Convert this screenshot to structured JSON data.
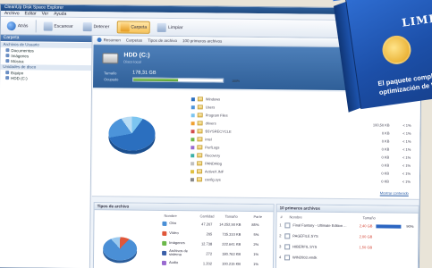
{
  "window": {
    "title": "CleanUp Disk Space Explorer"
  },
  "menu": [
    "Archivo",
    "Editar",
    "Ver",
    "Ayuda"
  ],
  "toolbar": {
    "back": "Atrás",
    "scan": "Escanear",
    "stop": "Detener",
    "folder_btn": "Carpeta",
    "clean_btn": "Limpiar"
  },
  "sidebar": {
    "header": "Carpeta",
    "group1": "Archivos de Usuario",
    "items1": [
      "Documentos",
      "Imágenes",
      "Música"
    ],
    "group2": "Unidades de disco",
    "items2": [
      "Equipo",
      "HDD (C:)"
    ]
  },
  "crumb": {
    "a": "Resumen",
    "b": "Carpetas",
    "c": "Tipos de archivo",
    "d": "100 primeros archivos"
  },
  "drive": {
    "title": "HDD (C:)",
    "subtitle": "Disco local",
    "cap_label": "Tamaño",
    "cap_value": "178,31 GB",
    "occ_label": "Ocupado",
    "occ_pct": "100%",
    "occ_fraction": 0.5
  },
  "folders": [
    {
      "name": "Windows",
      "size": "",
      "pct": ""
    },
    {
      "name": "Users",
      "size": "",
      "pct": ""
    },
    {
      "name": "Program Files",
      "size": "",
      "pct": ""
    },
    {
      "name": "drivers",
      "size": "100,50 KB",
      "pct": "< 1%"
    },
    {
      "name": "$SYSRECYCLE",
      "size": "0 KB",
      "pct": "< 1%"
    },
    {
      "name": "intel",
      "size": "0 KB",
      "pct": "< 1%"
    },
    {
      "name": "PerfLogs",
      "size": "0 KB",
      "pct": "< 1%"
    },
    {
      "name": "Recovery",
      "size": "0 KB",
      "pct": "< 1%"
    },
    {
      "name": "PANDAlog",
      "size": "0 KB",
      "pct": "< 1%"
    },
    {
      "name": "ActiveX.INF",
      "size": "0 KB",
      "pct": "< 1%"
    },
    {
      "name": "config.sys",
      "size": "0 KB",
      "pct": "< 1%"
    }
  ],
  "folder_colors": [
    "#2b6fbf",
    "#4c94da",
    "#7cc5f0",
    "#f0a030",
    "#d24c4c",
    "#6bb84a",
    "#9a6ad0",
    "#3cb0a8",
    "#c0c0c0",
    "#e0c040",
    "#888888"
  ],
  "more_link": "Mostrar contenido",
  "types_panel": {
    "title": "Tipos de archivo",
    "headers": [
      "Nombre",
      "Cantidad",
      "Tamaño",
      "Parte"
    ],
    "rows": [
      {
        "name": "Otro",
        "count": "47.207",
        "size": "14.252,50 KB",
        "pct": "85%",
        "color": "#4a8fd6"
      },
      {
        "name": "Vídeo",
        "count": "205",
        "size": "735.310 KB",
        "pct": "5%",
        "color": "#e0573a"
      },
      {
        "name": "Imágenes",
        "count": "12.738",
        "size": "222.641 KB",
        "pct": "2%",
        "color": "#6bb84a"
      },
      {
        "name": "Archivos de sistema",
        "count": "272",
        "size": "180.763 KB",
        "pct": "1%",
        "color": "#3a5fa8"
      },
      {
        "name": "Audio",
        "count": "1.202",
        "size": "100.215 KB",
        "pct": "1%",
        "color": "#9a6ad0"
      }
    ]
  },
  "largest_panel": {
    "title": "10 primeros archivos",
    "headers": [
      "#",
      "Nombre",
      "Tamaño"
    ],
    "rows": [
      {
        "n": "1",
        "name": "Final Fantasy - Ultimate Edition ...",
        "size": "2,40 GB",
        "pct": "90%"
      },
      {
        "n": "2",
        "name": "PAGEFILE.SYS",
        "size": "2,00 GB",
        "pct": ""
      },
      {
        "n": "3",
        "name": "HIBERFIL.SYS",
        "size": "1,50 GB",
        "pct": ""
      },
      {
        "n": "4",
        "name": "WIN2003.vmdk",
        "size": "",
        "pct": ""
      }
    ]
  },
  "product_box": {
    "word": "LIMPIA",
    "tagline1": "El paquete complet",
    "tagline2": "optimización de Wi"
  }
}
